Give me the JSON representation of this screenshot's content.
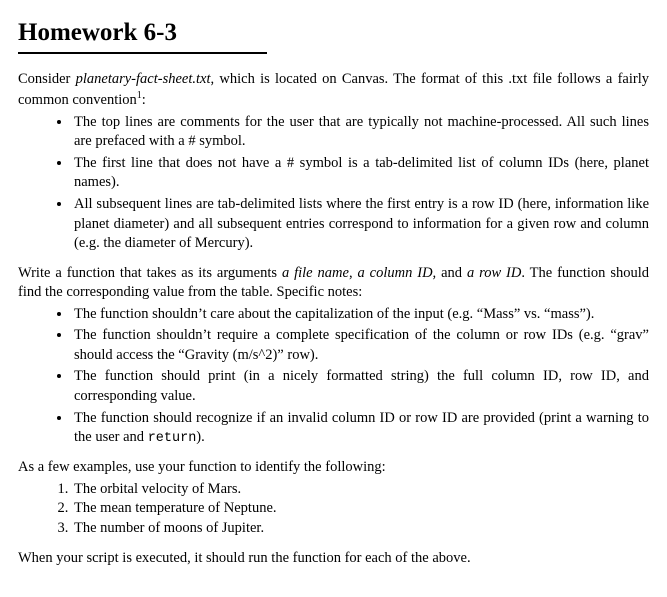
{
  "title": "Homework 6-3",
  "para1_a": "Consider ",
  "para1_file": "planetary-fact-sheet.txt",
  "para1_b": ", which is located on Canvas. The format of this .txt file follows a fairly common convention",
  "footnote_mark": "1",
  "para1_c": ":",
  "format_bullets": [
    "The top lines are comments for the user that are typically not machine-processed. All such lines are prefaced with a # symbol.",
    "The first line that does not have a # symbol is a tab-delimited list of column IDs (here, planet names).",
    "All subsequent lines are tab-delimited lists where the first entry is a row ID (here, information like planet diameter) and all subsequent entries correspond to information for a given row and column (e.g. the diameter of Mercury)."
  ],
  "para2_a": "Write a function that takes as its arguments ",
  "para2_args": "a file name",
  "para2_b": ", ",
  "para2_args2": "a column ID,",
  "para2_c": " and ",
  "para2_args3": "a row ID",
  "para2_d": ". The function should find the corresponding value from the table. Specific notes:",
  "notes_bullets": [
    "The function shouldn’t care about the capitalization of the input (e.g. “Mass” vs. “mass”).",
    "The function shouldn’t require a complete specification of the column or row IDs (e.g. “grav” should access the “Gravity (m/s^2)” row).",
    "The function should print (in a nicely formatted string) the full column ID, row ID, and corresponding value.",
    "The function should recognize if an invalid column ID or row ID are provided (print a warning to the user and "
  ],
  "return_word": "return",
  "return_tail": ").",
  "para3": "As a few examples, use your function to identify the following:",
  "examples": [
    "The orbital velocity of Mars.",
    "The mean temperature of Neptune.",
    "The number of moons of Jupiter."
  ],
  "para4": "When your script is executed, it should run the function for each of the above."
}
